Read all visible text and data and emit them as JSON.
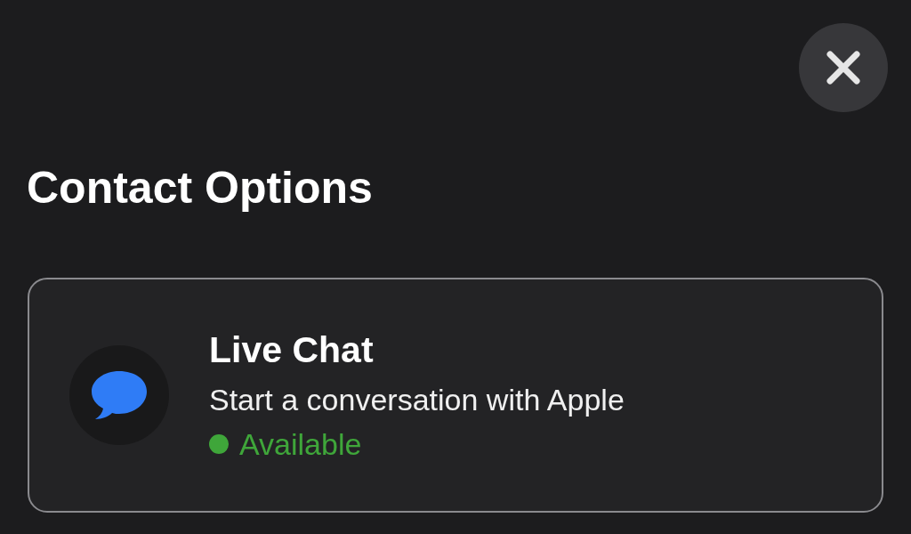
{
  "title": "Contact Options",
  "options": [
    {
      "kind": "chat",
      "title": "Live Chat",
      "subtitle": "Start a conversation with Apple",
      "status": "Available",
      "available": true
    }
  ]
}
